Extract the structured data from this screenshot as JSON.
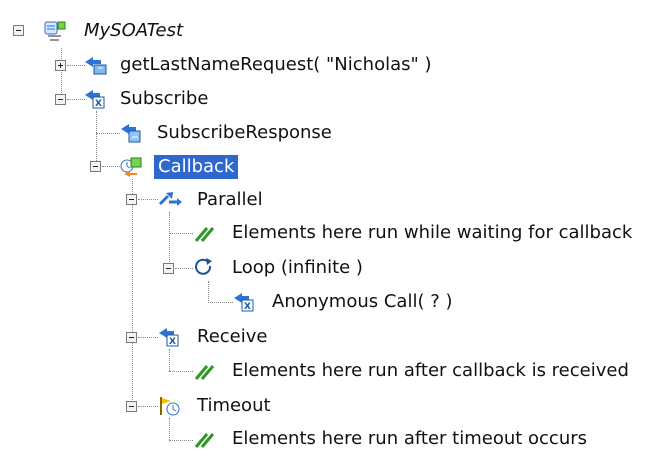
{
  "tree": {
    "root": "MySOATest",
    "items": [
      "getLastNameRequest( \"Nicholas\" )",
      "Subscribe",
      "SubscribeResponse",
      "Callback",
      "Parallel",
      "Elements here run while waiting for callback",
      "Loop (infinite )",
      "Anonymous Call(  ?  )",
      "Receive",
      "Elements here run after callback is received",
      "Timeout",
      "Elements here run after timeout occurs"
    ]
  }
}
